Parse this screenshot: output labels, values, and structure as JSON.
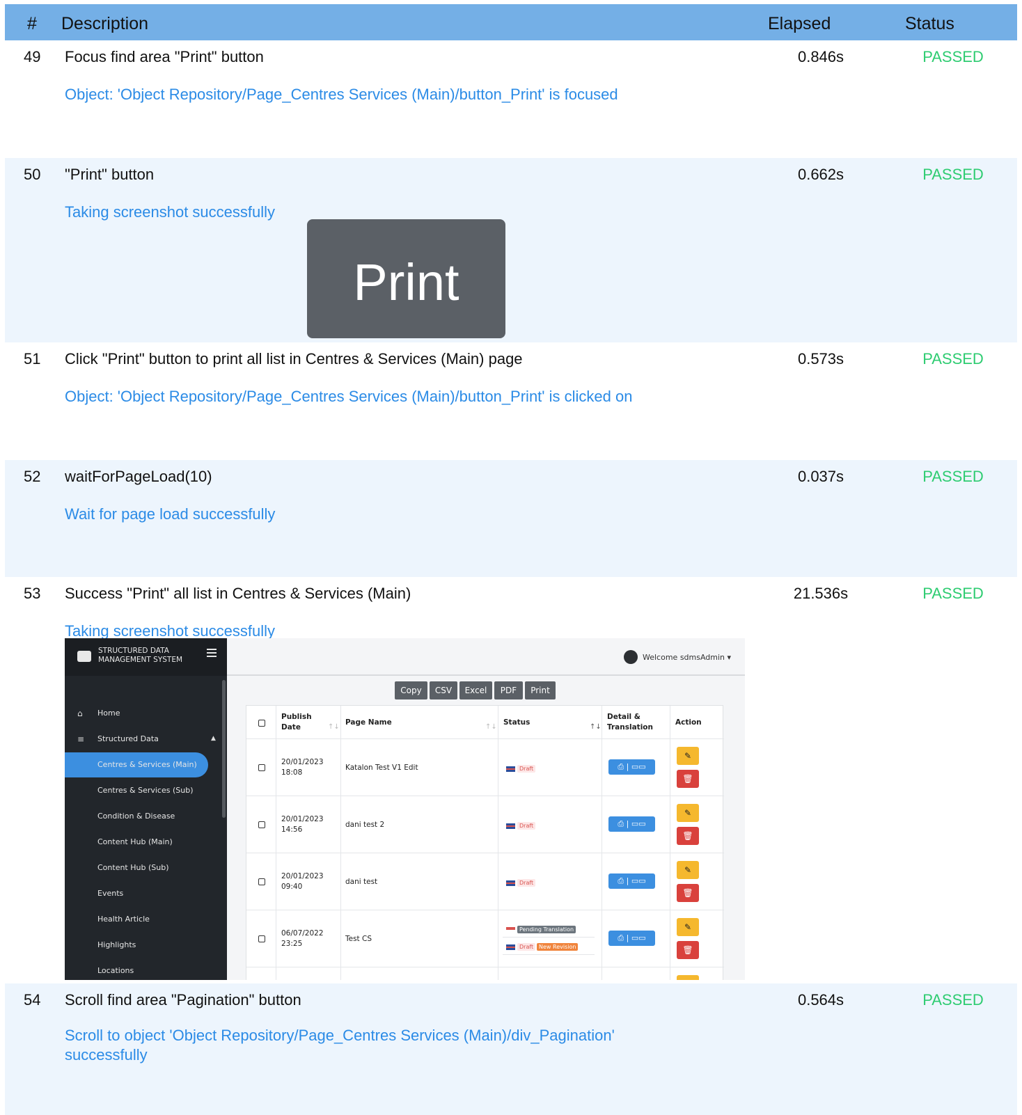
{
  "header": {
    "num": "#",
    "description": "Description",
    "elapsed": "Elapsed",
    "status": "Status"
  },
  "steps": [
    {
      "num": "49",
      "description": "Focus find area \"Print\" button",
      "elapsed": "0.846s",
      "status": "PASSED",
      "message": "Object: 'Object Repository/Page_Centres  Services (Main)/button_Print' is focused"
    },
    {
      "num": "50",
      "description": "\"Print\" button",
      "elapsed": "0.662s",
      "status": "PASSED",
      "message": "Taking screenshot successfully"
    },
    {
      "num": "51",
      "description": "Click \"Print\" button to print all list in Centres & Services (Main) page",
      "elapsed": "0.573s",
      "status": "PASSED",
      "message": "Object: 'Object Repository/Page_Centres  Services (Main)/button_Print' is clicked on"
    },
    {
      "num": "52",
      "description": "waitForPageLoad(10)",
      "elapsed": "0.037s",
      "status": "PASSED",
      "message": "Wait for page load successfully"
    },
    {
      "num": "53",
      "description": "Success \"Print\" all list in Centres & Services (Main)",
      "elapsed": "21.536s",
      "status": "PASSED",
      "message": "Taking screenshot successfully"
    },
    {
      "num": "54",
      "description": "Scroll find area \"Pagination\" button",
      "elapsed": "0.564s",
      "status": "PASSED",
      "message_line1": "Scroll to object 'Object Repository/Page_Centres  Services (Main)/div_Pagination'",
      "message_line2": "successfully"
    }
  ],
  "print_crop": {
    "label": "Print"
  },
  "app": {
    "brand_line1": "STRUCTURED DATA",
    "brand_line2": "MANAGEMENT SYSTEM",
    "welcome": "Welcome sdmsAdmin",
    "nav": [
      {
        "label": "Home",
        "icon": "home-icon"
      },
      {
        "label": "Structured Data",
        "icon": "database-icon"
      },
      {
        "label": "Centres & Services (Main)"
      },
      {
        "label": "Centres & Services (Sub)"
      },
      {
        "label": "Condition & Disease"
      },
      {
        "label": "Content Hub (Main)"
      },
      {
        "label": "Content Hub (Sub)"
      },
      {
        "label": "Events"
      },
      {
        "label": "Health Article"
      },
      {
        "label": "Highlights"
      },
      {
        "label": "Locations"
      }
    ],
    "export_buttons": [
      "Copy",
      "CSV",
      "Excel",
      "PDF",
      "Print"
    ],
    "columns": {
      "publish_line1": "Publish",
      "publish_line2": "Date",
      "page_name": "Page Name",
      "status": "Status",
      "detail_line1": "Detail &",
      "detail_line2": "Translation",
      "action": "Action"
    },
    "rows": [
      {
        "date": "20/01/2023",
        "time": "18:08",
        "name": "Katalon Test V1 Edit",
        "status": "Draft"
      },
      {
        "date": "20/01/2023",
        "time": "14:56",
        "name": "dani test 2",
        "status": "Draft"
      },
      {
        "date": "20/01/2023",
        "time": "09:40",
        "name": "dani test",
        "status": "Draft"
      },
      {
        "date": "06/07/2022",
        "time": "23:25",
        "name": "Test CS",
        "status": "Draft",
        "pending": "Pending Translation",
        "revision": "New Revision"
      }
    ],
    "colors": {
      "sidebar": "#22262b",
      "active": "#3c8fe0",
      "edit": "#f5b82e",
      "delete": "#d9413c"
    }
  }
}
